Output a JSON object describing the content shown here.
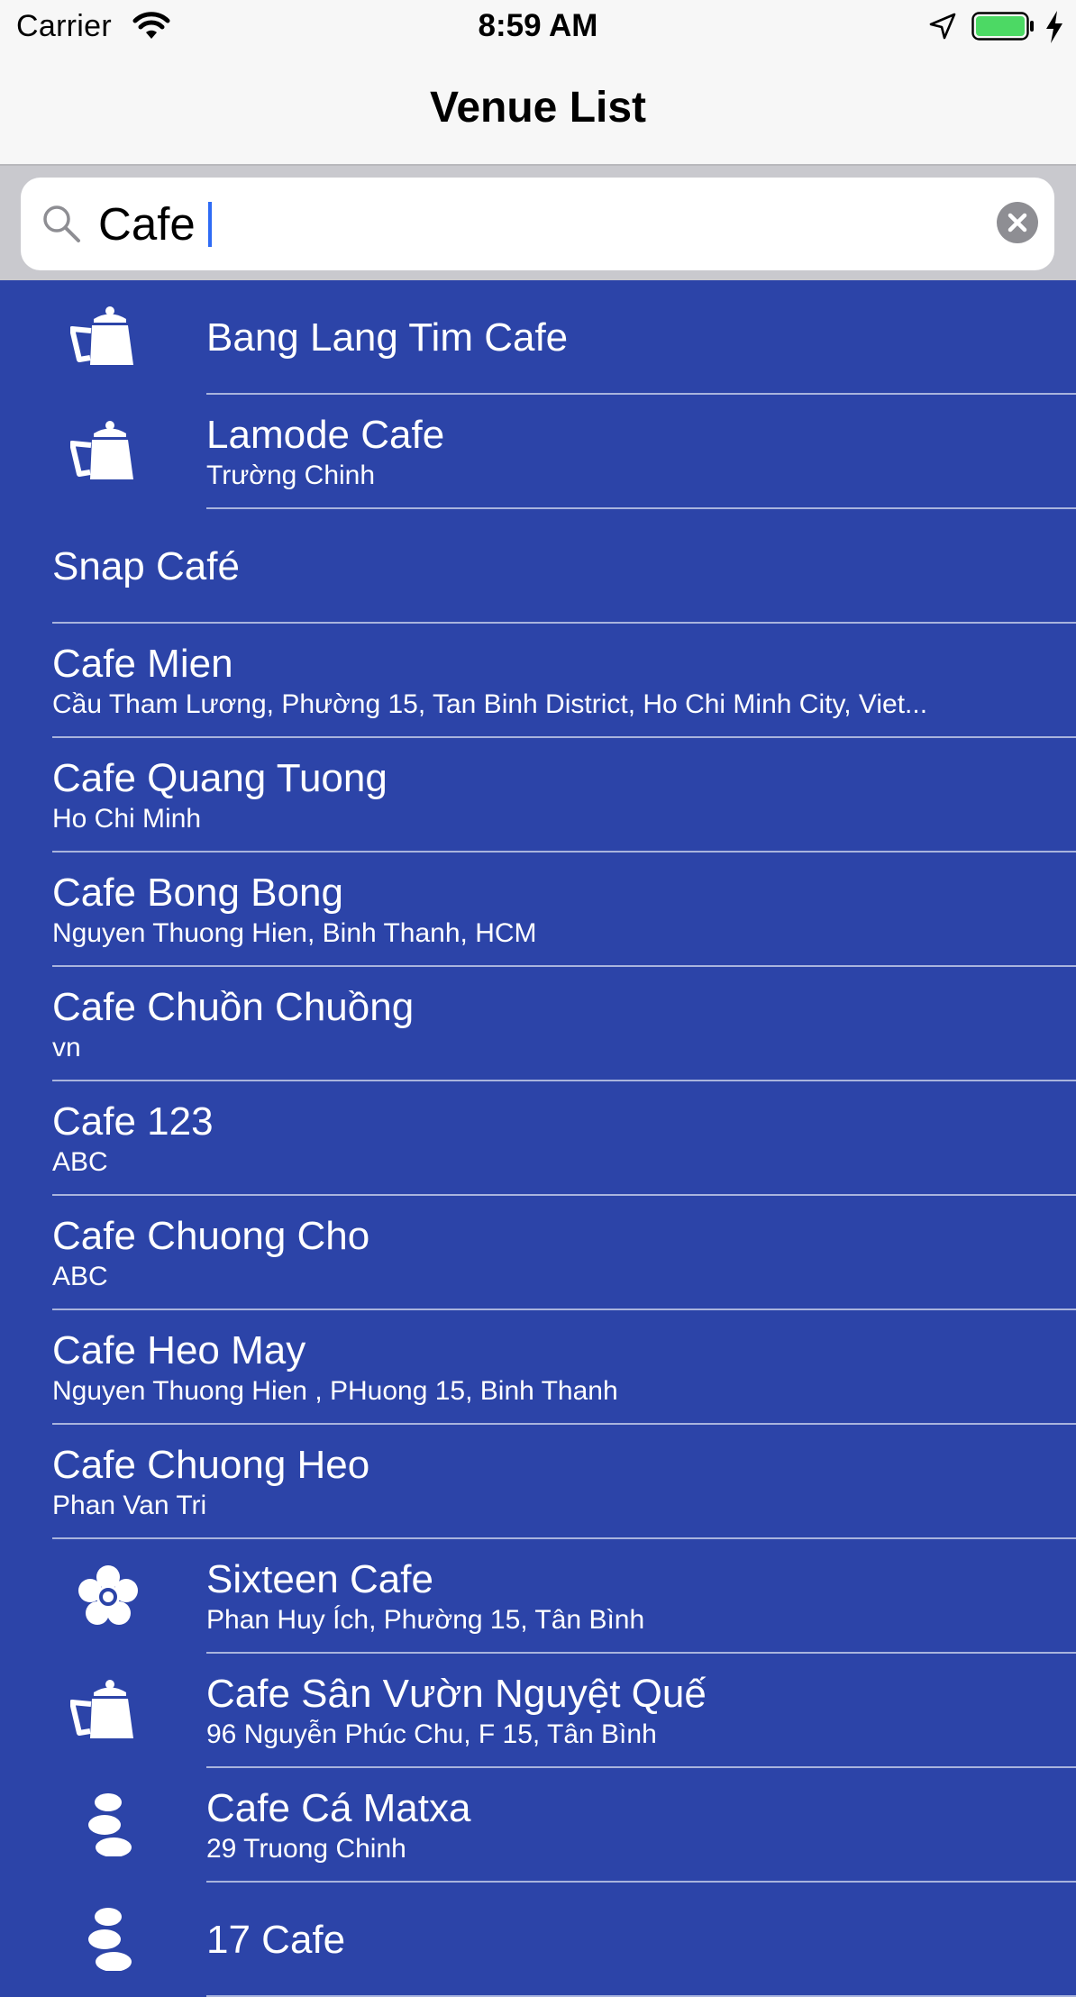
{
  "status_bar": {
    "carrier": "Carrier",
    "time": "8:59 AM"
  },
  "nav": {
    "title": "Venue List"
  },
  "search": {
    "value": "Cafe"
  },
  "colors": {
    "list_background": "#2c44a8",
    "separator": "#a9b4dd",
    "battery": "#4cd964",
    "caret": "#2f6bf5"
  },
  "venues": [
    {
      "name": "Bang Lang Tim Cafe",
      "subtitle": "",
      "icon": "teapot-icon"
    },
    {
      "name": "Lamode Cafe",
      "subtitle": "Trường Chinh",
      "icon": "teapot-icon"
    },
    {
      "name": "Snap Café",
      "subtitle": "",
      "icon": ""
    },
    {
      "name": "Cafe Mien",
      "subtitle": "Cầu Tham Lương, Phường 15, Tan Binh District, Ho Chi Minh City, Viet...",
      "icon": ""
    },
    {
      "name": "Cafe Quang Tuong",
      "subtitle": "Ho Chi Minh",
      "icon": ""
    },
    {
      "name": "Cafe Bong Bong",
      "subtitle": "Nguyen Thuong Hien, Binh Thanh, HCM",
      "icon": ""
    },
    {
      "name": "Cafe Chuồn Chuồng",
      "subtitle": "vn",
      "icon": ""
    },
    {
      "name": "Cafe 123",
      "subtitle": "ABC",
      "icon": ""
    },
    {
      "name": "Cafe Chuong Cho",
      "subtitle": "ABC",
      "icon": ""
    },
    {
      "name": "Cafe Heo May",
      "subtitle": "Nguyen Thuong Hien , PHuong 15, Binh Thanh",
      "icon": ""
    },
    {
      "name": "Cafe Chuong Heo",
      "subtitle": "Phan Van Tri",
      "icon": ""
    },
    {
      "name": "Sixteen Cafe",
      "subtitle": "Phan Huy Ích, Phường 15, Tân Bình",
      "icon": "flower-icon"
    },
    {
      "name": "Cafe Sân Vườn Nguyệt Quế",
      "subtitle": "96 Nguyễn Phúc Chu, F 15, Tân Bình",
      "icon": "teapot-icon"
    },
    {
      "name": "Cafe Cá Matxa",
      "subtitle": "29 Truong Chinh",
      "icon": "stones-icon"
    },
    {
      "name": "17 Cafe",
      "subtitle": "",
      "icon": "stones-icon"
    }
  ]
}
